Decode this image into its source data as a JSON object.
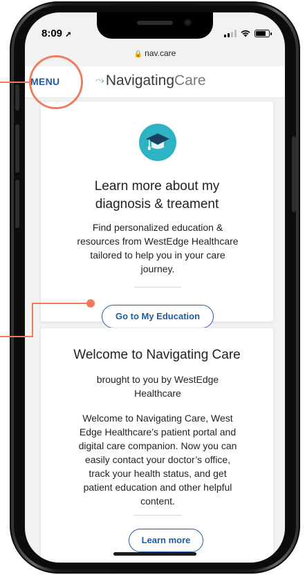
{
  "status_bar": {
    "time": "8:09",
    "location_arrow": "location-arrow-icon"
  },
  "browser": {
    "url": "nav.care"
  },
  "header": {
    "menu_label": "MENU",
    "brand_part1": "Navigating",
    "brand_part2": "Care"
  },
  "education_card": {
    "icon": "graduation-cap-icon",
    "title_line1": "Learn more about my",
    "title_line2": "diagnosis & treament",
    "body_line1": "Find personalized education &",
    "body_line2": "resources from WestEdge Healthcare",
    "body_line3": "tailored to help you in your care",
    "body_line4": "journey.",
    "button_label": "Go to My Education"
  },
  "welcome_card": {
    "title": "Welcome to Navigating Care",
    "sub_line1": "brought to you by WestEdge",
    "sub_line2": "Healthcare",
    "body_line1": "Welcome to Navigating Care, West",
    "body_line2": "Edge Healthcare’s patient portal and",
    "body_line3": "digital care companion. Now you can",
    "body_line4": "easily contact your doctor’s office,",
    "body_line5": "track your health status, and get",
    "body_line6": "patient education and other helpful",
    "body_line7": "content.",
    "button_label": "Learn more"
  },
  "colors": {
    "accent": "#1f5aa6",
    "callout": "#f27b5d",
    "icon_bg": "#2db3c3",
    "brand_mark": "#5bb89c"
  }
}
